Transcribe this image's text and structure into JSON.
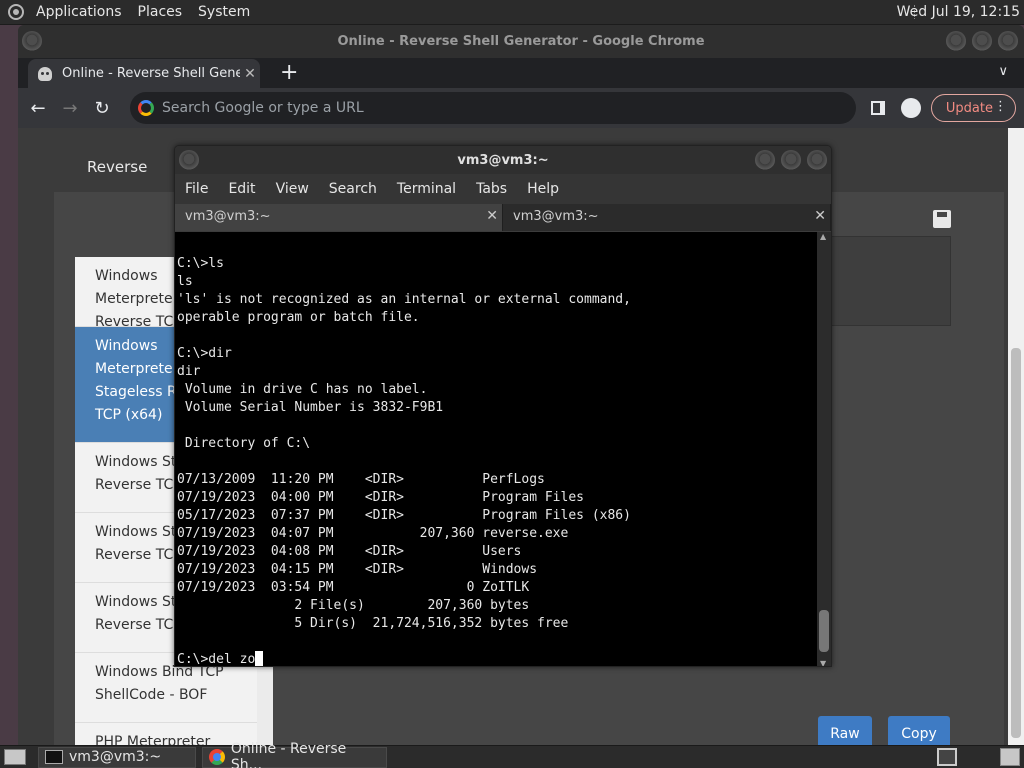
{
  "top_panel": {
    "menus": [
      "Applications",
      "Places",
      "System"
    ],
    "clock": "Wed Jul 19, 12:15"
  },
  "chrome": {
    "window_title": "Online - Reverse Shell Generator - Google Chrome",
    "tab_title": "Online - Reverse Shell Genera",
    "omnibox_placeholder": "Search Google or type a URL",
    "update_label": "Update"
  },
  "page": {
    "reverse_tab": "Reverse",
    "list_items": [
      [
        "Windows",
        "Meterprete",
        "Reverse TCP"
      ],
      [
        "Windows",
        "Meterprete",
        "Stageless Re",
        "TCP (x64)"
      ],
      [
        "Windows St",
        "Reverse TCP"
      ],
      [
        "Windows St",
        "Reverse TCP"
      ],
      [
        "Windows St",
        "Reverse TCP"
      ],
      [
        "Windows Bind TCP",
        "ShellCode - BOF"
      ],
      [
        "PHP Meterpreter"
      ]
    ],
    "raw_label": "Raw",
    "copy_label": "Copy"
  },
  "terminal": {
    "title": "vm3@vm3:~",
    "menu": [
      "File",
      "Edit",
      "View",
      "Search",
      "Terminal",
      "Tabs",
      "Help"
    ],
    "tabs": [
      "vm3@vm3:~",
      "vm3@vm3:~"
    ],
    "lines": [
      "",
      "C:\\>ls",
      "ls",
      "'ls' is not recognized as an internal or external command,",
      "operable program or batch file.",
      "",
      "C:\\>dir",
      "dir",
      " Volume in drive C has no label.",
      " Volume Serial Number is 3832-F9B1",
      "",
      " Directory of C:\\",
      "",
      "07/13/2009  11:20 PM    <DIR>          PerfLogs",
      "07/19/2023  04:00 PM    <DIR>          Program Files",
      "05/17/2023  07:37 PM    <DIR>          Program Files (x86)",
      "07/19/2023  04:07 PM           207,360 reverse.exe",
      "07/19/2023  04:08 PM    <DIR>          Users",
      "07/19/2023  04:15 PM    <DIR>          Windows",
      "07/19/2023  03:54 PM                 0 ZoITLK",
      "               2 File(s)        207,360 bytes",
      "               5 Dir(s)  21,724,516,352 bytes free",
      ""
    ],
    "prompt_line": "C:\\>del zo"
  },
  "taskbar": {
    "tasks": [
      "vm3@vm3:~",
      "Online - Reverse Sh..."
    ]
  }
}
